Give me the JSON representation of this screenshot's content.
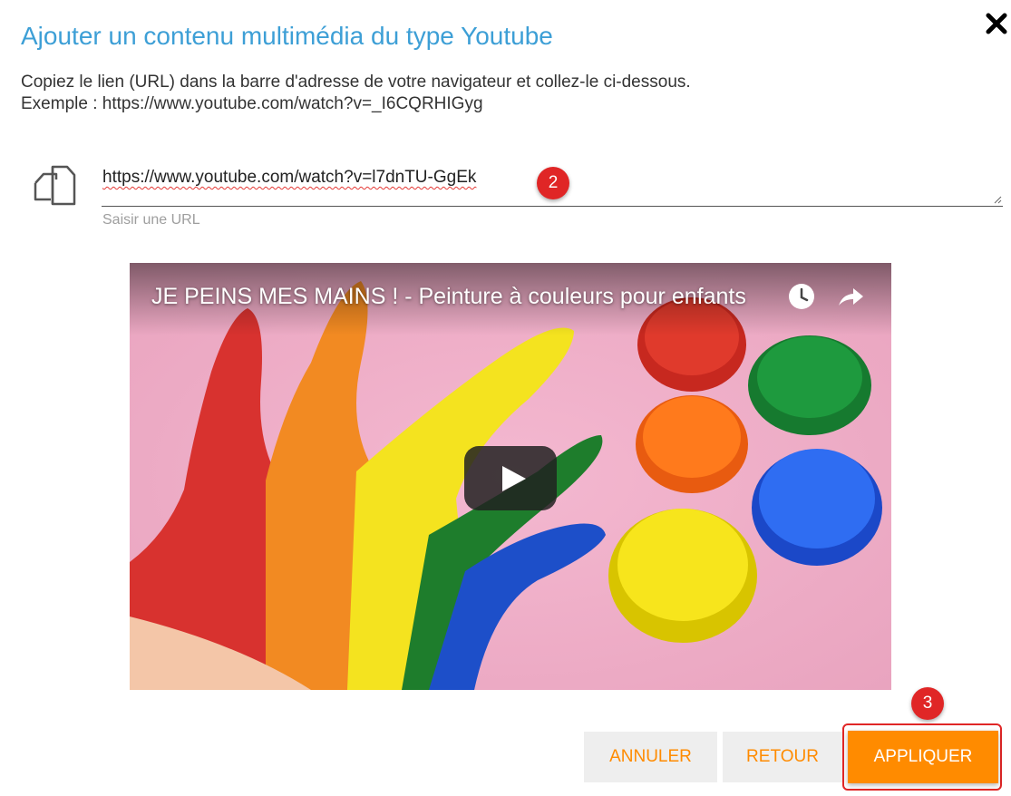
{
  "dialog": {
    "title": "Ajouter un contenu multimédia du type Youtube",
    "instruction": "Copiez le lien (URL) dans la barre d'adresse de votre navigateur et collez-le ci-dessous.",
    "example": "Exemple : https://www.youtube.com/watch?v=_I6CQRHIGyg",
    "close_icon": "close-icon"
  },
  "url_field": {
    "value": "https://www.youtube.com/watch?v=l7dnTU-GgEk",
    "helper": "Saisir une URL",
    "icon": "copy-icon"
  },
  "video": {
    "title": "JE PEINS MES MAINS ! - Peinture à couleurs pour enfants",
    "icons": [
      "clock-icon",
      "share-icon",
      "play-icon"
    ]
  },
  "annotations": {
    "step_2": "2",
    "step_3": "3"
  },
  "actions": {
    "cancel_label": "ANNULER",
    "back_label": "RETOUR",
    "apply_label": "APPLIQUER"
  },
  "colors": {
    "title": "#3d9fd6",
    "accent": "#ff8b00",
    "badge": "#e02626"
  }
}
